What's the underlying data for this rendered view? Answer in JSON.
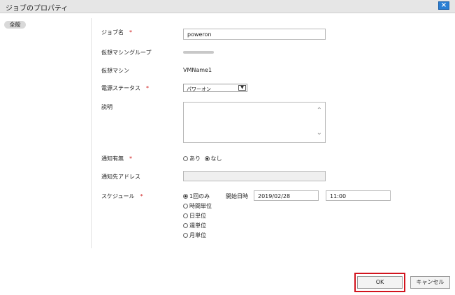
{
  "dialog": {
    "title": "ジョブのプロパティ",
    "close_icon": "×"
  },
  "tab": {
    "label": "全般"
  },
  "form": {
    "job_name": {
      "label": "ジョブ名",
      "required_mark": "*",
      "value": "poweron"
    },
    "vm_group": {
      "label": "仮想マシングループ"
    },
    "vm": {
      "label": "仮想マシン",
      "value": "VMName1"
    },
    "power_status": {
      "label": "電源ステータス",
      "required_mark": "*",
      "selected": "パワーオン",
      "arrow": "▼"
    },
    "description": {
      "label": "説明",
      "scroll_up": "⌃",
      "scroll_down": "⌄"
    },
    "notify": {
      "label": "通知有無",
      "required_mark": "*",
      "options": [
        "あり",
        "なし"
      ],
      "selected": "なし"
    },
    "notify_address": {
      "label": "通知先アドレス"
    },
    "schedule": {
      "label": "スケジュール",
      "required_mark": "*",
      "options": [
        "1回のみ",
        "時間単位",
        "日単位",
        "週単位",
        "月単位"
      ],
      "selected": "1回のみ",
      "start_label": "開始日時",
      "start_date": "2019/02/28",
      "start_time": "11:00"
    }
  },
  "footer": {
    "ok_label": "OK",
    "cancel_label": "キャンセル"
  }
}
